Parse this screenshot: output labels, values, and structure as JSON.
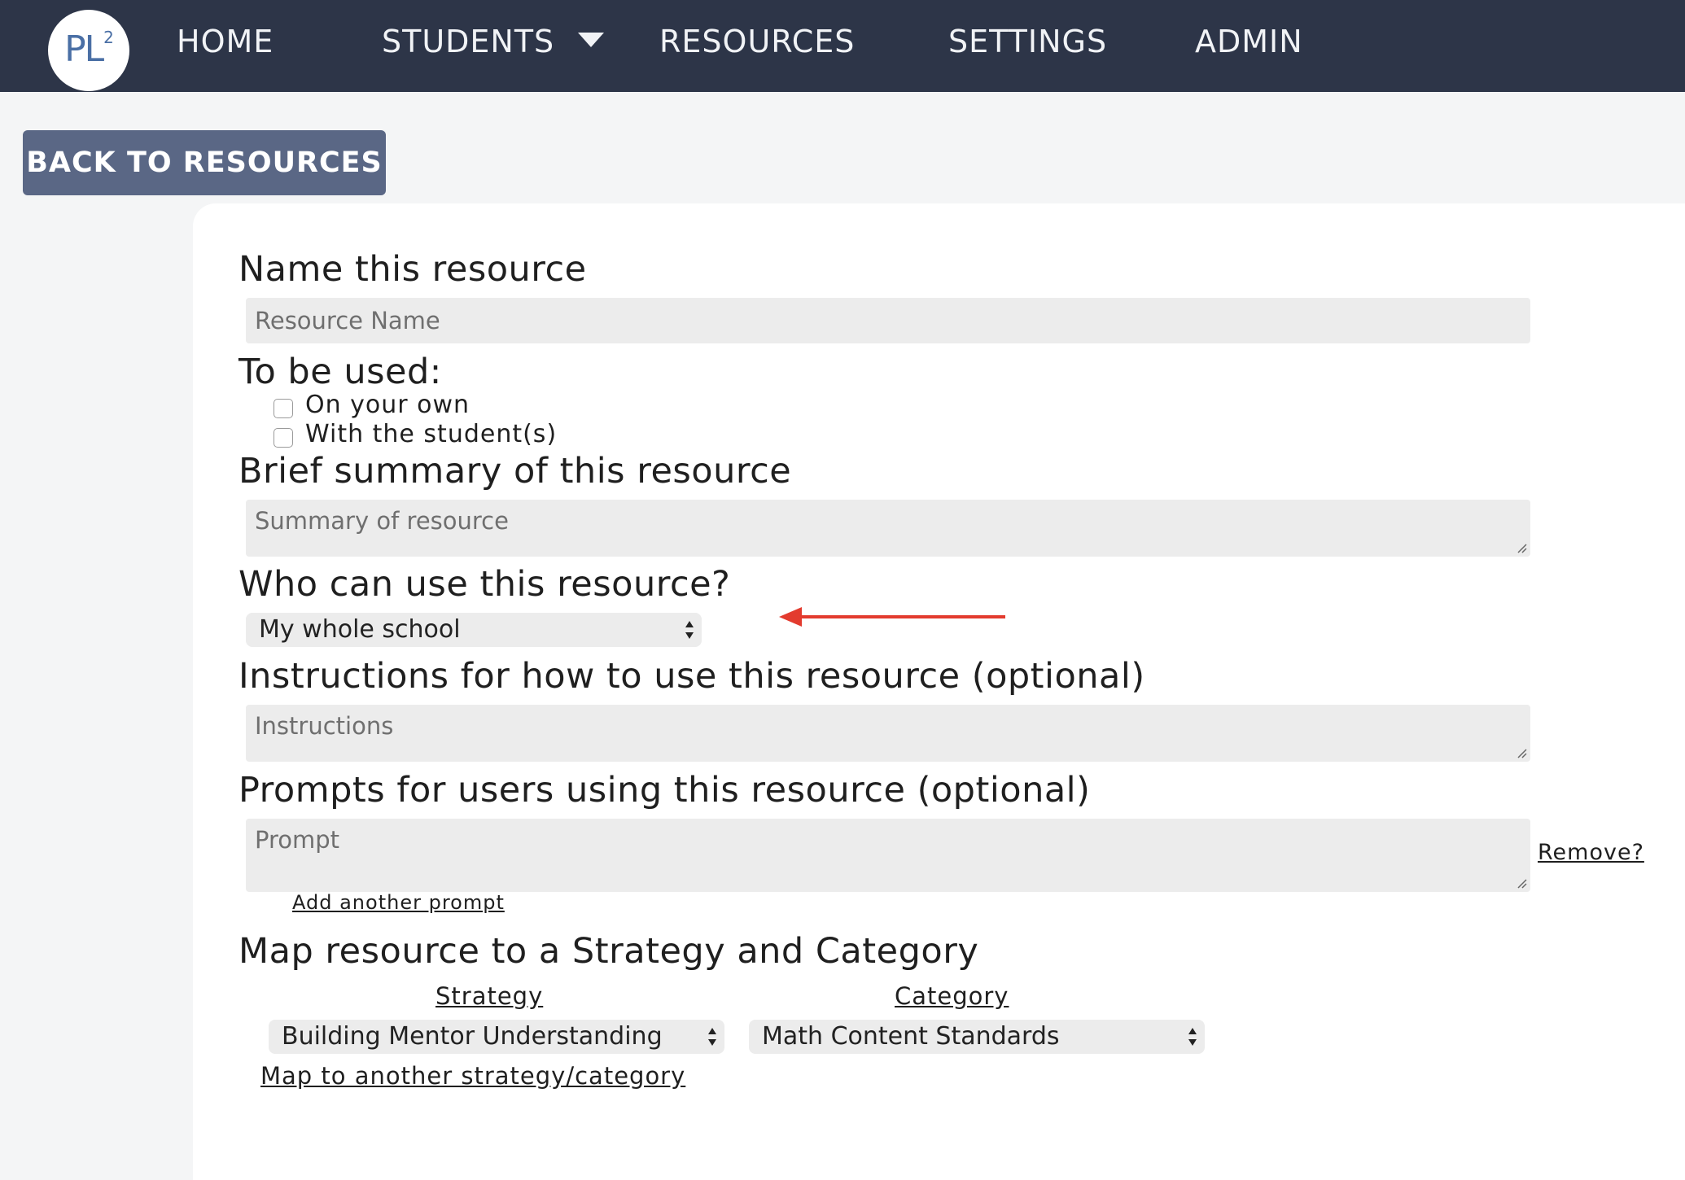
{
  "nav": {
    "logo_text": "PL",
    "logo_superscript": "2",
    "items": [
      "HOME",
      "STUDENTS",
      "RESOURCES",
      "SETTINGS",
      "ADMIN"
    ]
  },
  "back_button": "BACK TO RESOURCES",
  "form": {
    "name_heading": "Name this resource",
    "name_placeholder": "Resource Name",
    "usage_heading": "To be used:",
    "usage_options": [
      "On your own",
      "With the student(s)"
    ],
    "summary_heading": "Brief summary of this resource",
    "summary_placeholder": "Summary of resource",
    "who_heading": "Who can use this resource?",
    "who_selected": "My whole school",
    "instructions_heading": "Instructions for how to use this resource (optional)",
    "instructions_placeholder": "Instructions",
    "prompts_heading": "Prompts for users using this resource (optional)",
    "prompt_placeholder": "Prompt",
    "remove_link": "Remove?",
    "add_prompt_link": "Add another prompt",
    "map_heading": "Map resource to a Strategy and Category",
    "strategy_label": "Strategy",
    "category_label": "Category",
    "strategy_selected": "Building Mentor Understanding",
    "category_selected": "Math Content Standards",
    "map_another_link": "Map to another strategy/category"
  },
  "colors": {
    "nav_bg": "#2d3548",
    "button_bg": "#5a6785",
    "arrow_annotation": "#e33b2e"
  }
}
